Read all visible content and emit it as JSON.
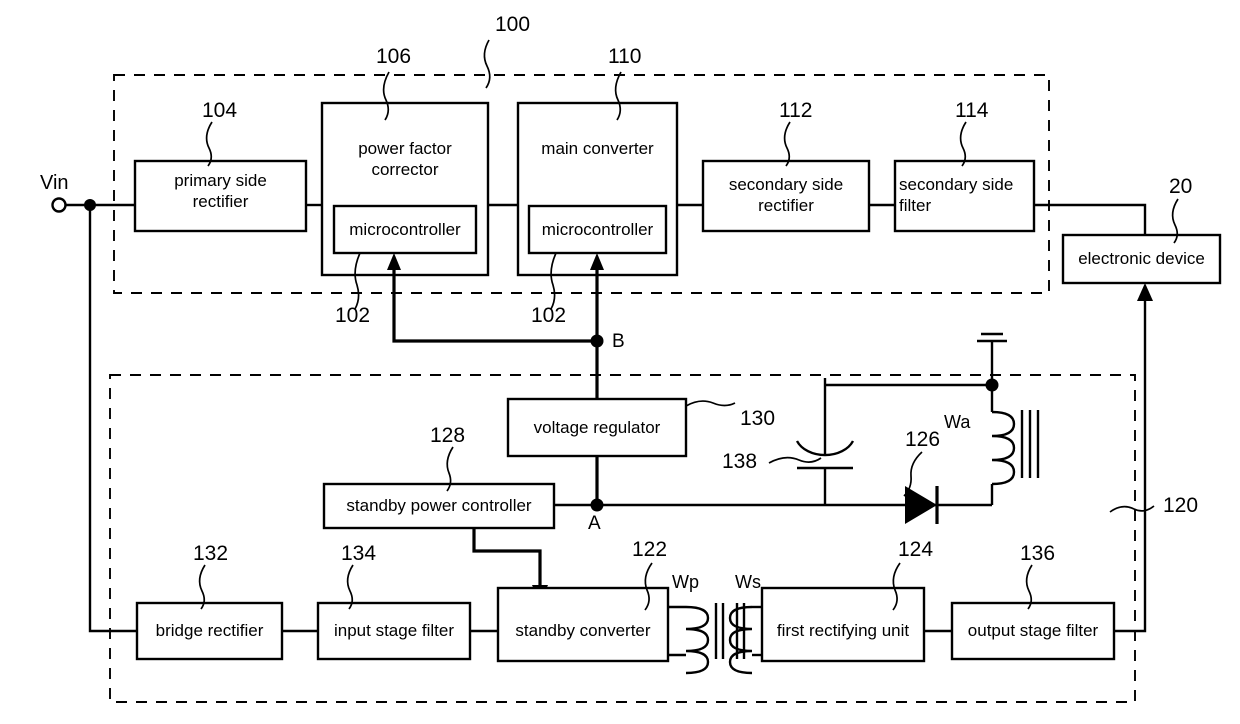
{
  "diagram": {
    "title": "switching power supply block diagram",
    "terminals": [
      {
        "name": "vin",
        "label": "Vin"
      }
    ],
    "nodes": [
      {
        "name": "node-b",
        "label": "B"
      },
      {
        "name": "node-a",
        "label": "A"
      }
    ],
    "blocks": [
      {
        "id": "primary-side-rectifier",
        "label": "primary side\nrectifier",
        "ref": "104"
      },
      {
        "id": "power-factor-corrector",
        "label": "power factor\ncorrector",
        "ref": "106"
      },
      {
        "id": "pfc-microcontroller",
        "label": "microcontroller",
        "ref": "102"
      },
      {
        "id": "main-converter",
        "label": "main converter",
        "ref": "110"
      },
      {
        "id": "main-microcontroller",
        "label": "microcontroller",
        "ref": "102"
      },
      {
        "id": "secondary-side-rectifier",
        "label": "secondary side\nrectifier",
        "ref": "112"
      },
      {
        "id": "secondary-side-filter",
        "label": "secondary side\nfilter",
        "ref": "114"
      },
      {
        "id": "electronic-device",
        "label": "electronic device",
        "ref": "20"
      },
      {
        "id": "voltage-regulator",
        "label": "voltage regulator",
        "ref": "130"
      },
      {
        "id": "standby-power-controller",
        "label": "standby power controller",
        "ref": "128"
      },
      {
        "id": "bridge-rectifier",
        "label": "bridge rectifier",
        "ref": "132"
      },
      {
        "id": "input-stage-filter",
        "label": "input stage filter",
        "ref": "134"
      },
      {
        "id": "standby-converter",
        "label": "standby converter",
        "ref": "122"
      },
      {
        "id": "first-rectifying-unit",
        "label": "first rectifying unit",
        "ref": "124"
      },
      {
        "id": "output-stage-filter",
        "label": "output stage filter",
        "ref": "136"
      }
    ],
    "components": [
      {
        "id": "capacitor",
        "ref": "138",
        "type": "polarized-capacitor"
      },
      {
        "id": "diode",
        "ref": "126",
        "type": "diode"
      },
      {
        "id": "auxiliary-winding",
        "ref": "Wa",
        "type": "transformer-winding"
      },
      {
        "id": "primary-winding",
        "ref": "Wp",
        "type": "transformer-winding"
      },
      {
        "id": "secondary-winding",
        "ref": "Ws",
        "type": "transformer-winding"
      },
      {
        "id": "ground",
        "ref": "",
        "type": "ground-symbol"
      }
    ],
    "enclosures": [
      {
        "id": "main-power-section",
        "ref": "100"
      },
      {
        "id": "standby-power-section",
        "ref": "120"
      }
    ],
    "winding_labels": {
      "wa": "Wa",
      "wp": "Wp",
      "ws": "Ws"
    },
    "ref_numbers": {
      "r100": "100",
      "r102a": "102",
      "r102b": "102",
      "r104": "104",
      "r106": "106",
      "r110": "110",
      "r112": "112",
      "r114": "114",
      "r20": "20",
      "r120": "120",
      "r122": "122",
      "r124": "124",
      "r126": "126",
      "r128": "128",
      "r130": "130",
      "r132": "132",
      "r134": "134",
      "r136": "136",
      "r138": "138"
    },
    "labels": {
      "primary_side_rectifier": "primary side\nrectifier",
      "power_factor_corrector": "power factor\ncorrector",
      "microcontroller_a": "microcontroller",
      "main_converter": "main converter",
      "microcontroller_b": "microcontroller",
      "secondary_side_rectifier": "secondary side\nrectifier",
      "secondary_side_filter": "secondary side\nfilter",
      "electronic_device": "electronic device",
      "voltage_regulator": "voltage regulator",
      "standby_power_controller": "standby power controller",
      "bridge_rectifier": "bridge rectifier",
      "input_stage_filter": "input stage filter",
      "standby_converter": "standby converter",
      "first_rectifying_unit": "first rectifying unit",
      "output_stage_filter": "output stage filter",
      "vin": "Vin",
      "node_a": "A",
      "node_b": "B"
    },
    "colors": {
      "stroke": "#000000",
      "background": "#ffffff"
    }
  }
}
